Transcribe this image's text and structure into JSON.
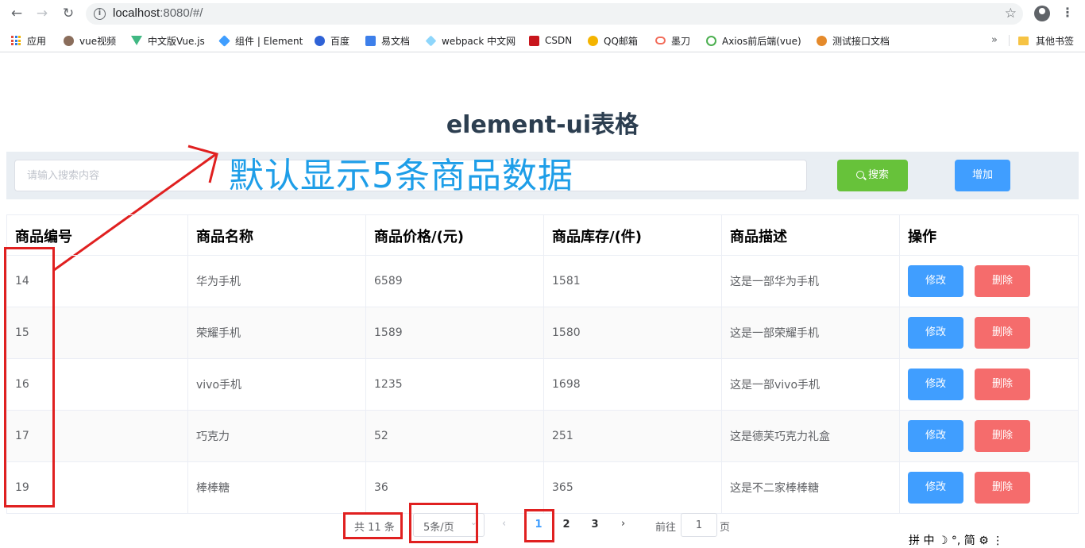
{
  "browser": {
    "url_host": "localhost",
    "url_rest": ":8080/#/",
    "bookmarks": [
      {
        "label": "应用",
        "icon": "apps-grid-icon"
      },
      {
        "label": "vue视频",
        "icon": "avatar-icon",
        "color": "#8a6d5b"
      },
      {
        "label": "中文版Vue.js",
        "icon": "vue-logo-icon",
        "color": "#41b883"
      },
      {
        "label": "组件 | Element",
        "icon": "element-logo-icon",
        "color": "#409eff"
      },
      {
        "label": "百度",
        "icon": "baidu-paw-icon",
        "color": "#2f62d6"
      },
      {
        "label": "易文档",
        "icon": "doc-icon",
        "color": "#3d7fea"
      },
      {
        "label": "webpack 中文网",
        "icon": "webpack-cube-icon",
        "color": "#8ed6fb"
      },
      {
        "label": "CSDN",
        "icon": "csdn-logo-icon",
        "color": "#c8161d"
      },
      {
        "label": "QQ邮箱",
        "icon": "qq-mail-icon",
        "color": "#f4b400"
      },
      {
        "label": "墨刀",
        "icon": "modao-icon",
        "color": "#f26d5b"
      },
      {
        "label": "Axios前后端(vue)",
        "icon": "axios-icon",
        "color": "#4caf50"
      },
      {
        "label": "测试接口文档",
        "icon": "api-doc-icon",
        "color": "#e58a2b"
      }
    ],
    "other_bookmarks": "其他书签"
  },
  "page": {
    "title": "element-ui表格",
    "search_placeholder": "请输入搜索内容",
    "search_button": "搜索",
    "add_button": "增加",
    "annotation": "默认显示5条商品数据"
  },
  "table": {
    "headers": [
      "商品编号",
      "商品名称",
      "商品价格/(元)",
      "商品库存/(件)",
      "商品描述",
      "操作"
    ],
    "rows": [
      {
        "id": "14",
        "name": "华为手机",
        "price": "6589",
        "stock": "1581",
        "desc": "这是一部华为手机"
      },
      {
        "id": "15",
        "name": "荣耀手机",
        "price": "1589",
        "stock": "1580",
        "desc": "这是一部荣耀手机"
      },
      {
        "id": "16",
        "name": "vivo手机",
        "price": "1235",
        "stock": "1698",
        "desc": "这是一部vivo手机"
      },
      {
        "id": "17",
        "name": "巧克力",
        "price": "52",
        "stock": "251",
        "desc": "这是德芙巧克力礼盒"
      },
      {
        "id": "19",
        "name": "棒棒糖",
        "price": "36",
        "stock": "365",
        "desc": "这是不二家棒棒糖"
      }
    ],
    "edit_label": "修改",
    "delete_label": "删除"
  },
  "pagination": {
    "total": "共 11 条",
    "page_size": "5条/页",
    "pages": [
      "1",
      "2",
      "3"
    ],
    "current": "1",
    "goto_label": "前往",
    "goto_value": "1",
    "page_suffix": "页"
  },
  "ime_status": "拼 中 ☽ °, 简 ⚙ ⋮",
  "colors": {
    "primary": "#409eff",
    "success": "#67c23a",
    "danger": "#f56c6c",
    "annotation_red": "#e02020",
    "annotation_blue": "#1e9ee8"
  }
}
